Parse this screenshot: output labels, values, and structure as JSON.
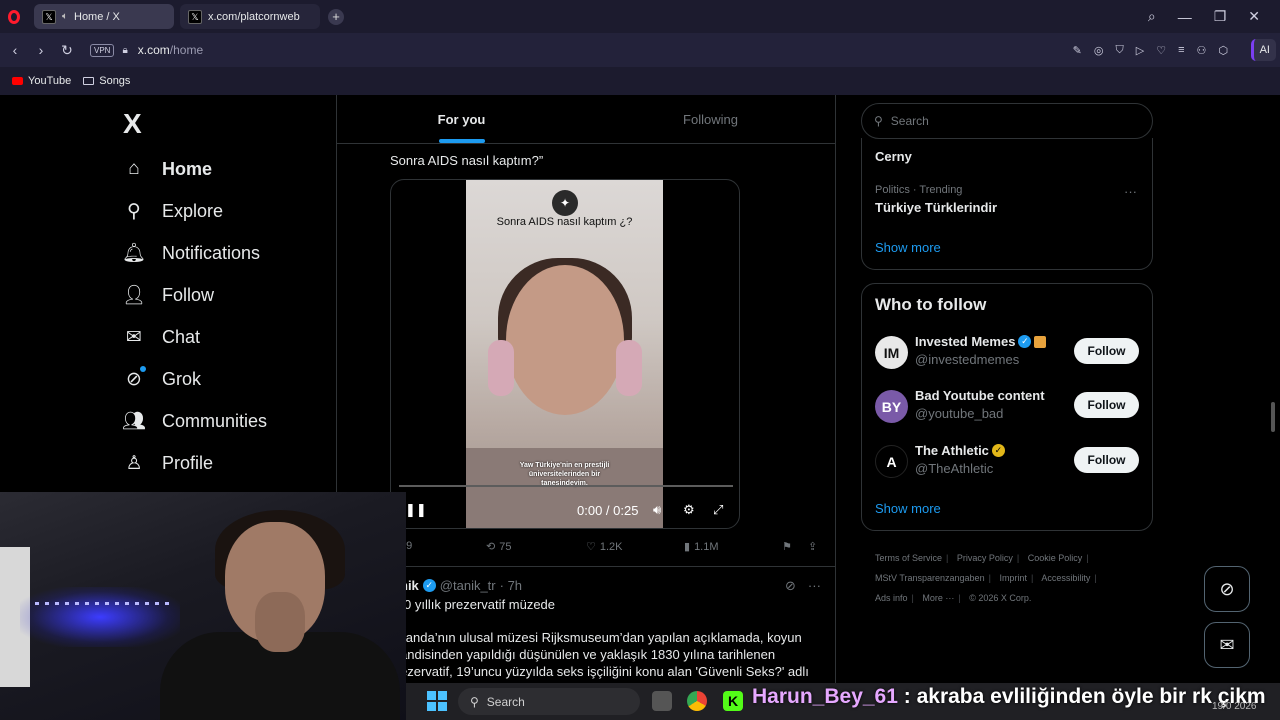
{
  "browser": {
    "tabs": [
      {
        "title": "Home / X",
        "active": true
      },
      {
        "title": "x.com/platcornweb",
        "active": false
      }
    ],
    "new_tab_symbol": "+",
    "vpn_label": "VPN",
    "url_host": "x.com",
    "url_path": "/home",
    "ai_label": "AI",
    "bookmarks": [
      {
        "label": "YouTube",
        "icon": "youtube-icon"
      },
      {
        "label": "Songs",
        "icon": "folder-icon"
      }
    ]
  },
  "nav": {
    "logo": "X",
    "items": [
      {
        "label": "Home",
        "icon": "home-icon",
        "active": true
      },
      {
        "label": "Explore",
        "icon": "search-icon"
      },
      {
        "label": "Notifications",
        "icon": "bell-icon"
      },
      {
        "label": "Follow",
        "icon": "person-add-icon"
      },
      {
        "label": "Chat",
        "icon": "mail-icon"
      },
      {
        "label": "Grok",
        "icon": "grok-icon"
      },
      {
        "label": "Communities",
        "icon": "communities-icon"
      },
      {
        "label": "Profile",
        "icon": "person-icon"
      }
    ]
  },
  "feed": {
    "tabs": [
      {
        "label": "For you",
        "active": true
      },
      {
        "label": "Following",
        "active": false
      }
    ],
    "tweet1": {
      "text_tail": "Sonra AIDS nasıl kaptım?”",
      "video": {
        "title_overlay": "Sonra AIDS nasıl kaptım ¿?",
        "caption_lines": [
          "Yaw Türkiye'nin en prestijli",
          "üniversitelerinden bir",
          "tanesindeyim."
        ],
        "time": "0:00 / 0:25",
        "progress_fraction": 0.0
      },
      "stats": {
        "replies": "89",
        "reposts": "75",
        "likes": "1.2K",
        "views": "1.1M"
      }
    },
    "tweet2": {
      "name_visible": "nik",
      "handle": "@tanik_tr",
      "time": "· 7h",
      "first_line": "0 yıllık prezervatif müzede",
      "body": [
        "llanda’nın ulusal müzesi Rijksmuseum’dan yapılan açıklamada, koyun",
        "andisinden yapıldığı düşünülen ve yaklaşık 1830 yılına tarihlenen",
        "ezervatif, 19’uncu yüzyılda seks işçiliğini konu alan 'Güvenli Seks?' adlı"
      ]
    }
  },
  "sidebar": {
    "search_placeholder": "Search",
    "trends": {
      "cut_name": "Cerny",
      "trend_meta": "Politics · Trending",
      "trend_name": "Türkiye Türklerindir",
      "more_symbol": "···",
      "show_more": "Show more"
    },
    "who_to_follow": {
      "title": "Who to follow",
      "accounts": [
        {
          "name": "Invested Memes",
          "handle": "@investedmemes",
          "verified": "blue",
          "avatar": "IM"
        },
        {
          "name": "Bad Youtube content",
          "handle": "@youtube_bad",
          "verified": "none",
          "avatar": "BY"
        },
        {
          "name": "The Athletic",
          "handle": "@TheAthletic",
          "verified": "gold",
          "avatar": "A"
        }
      ],
      "follow_label": "Follow",
      "show_more": "Show more"
    },
    "footer_links": [
      "Terms of Service",
      "Privacy Policy",
      "Cookie Policy",
      "MStV Transparenzangaben",
      "Imprint",
      "Accessibility",
      "Ads info",
      "More ···",
      "© 2026 X Corp."
    ]
  },
  "taskbar": {
    "search_label": "Search",
    "chat_user": "Harun_Bey_61",
    "chat_text": ": akraba evliliğinden öyle bir rk çikm",
    "date_partial": "19/0  2026"
  },
  "colors": {
    "accent": "#1d9bf0",
    "background": "#000000",
    "border": "#2f3336",
    "muted": "#71767b"
  }
}
